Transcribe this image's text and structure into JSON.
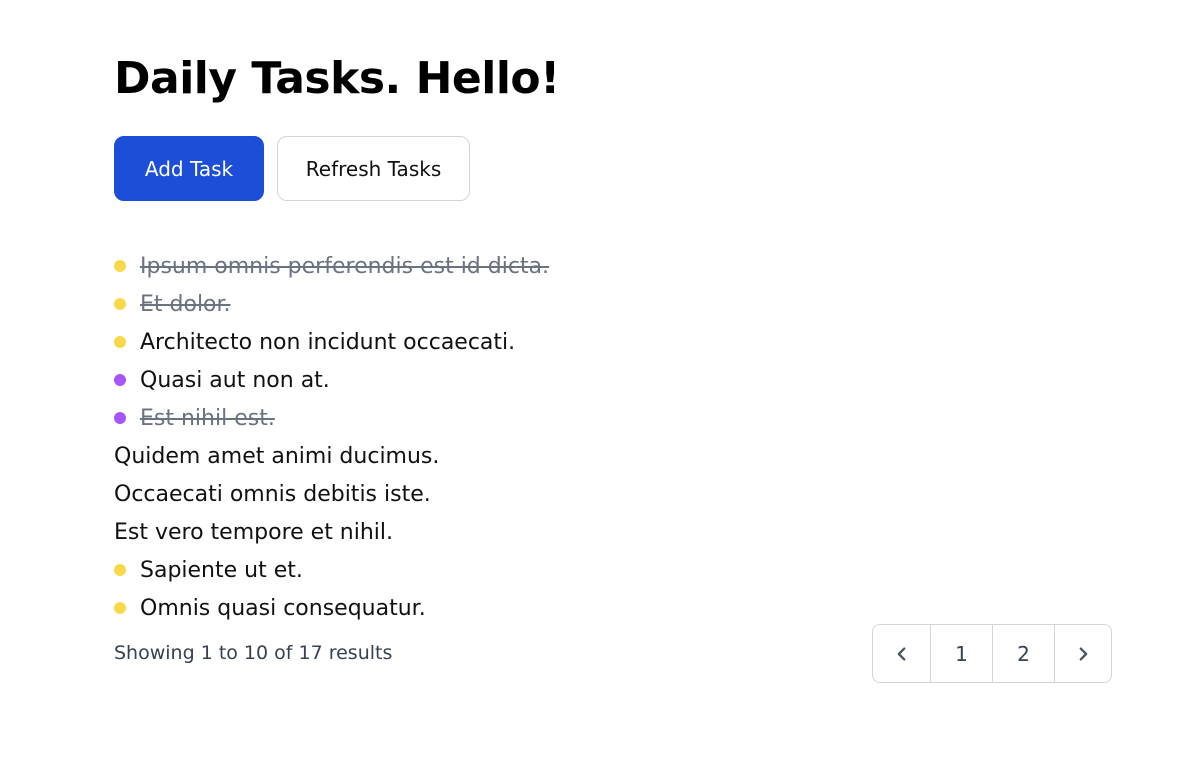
{
  "page": {
    "title": "Daily Tasks. Hello!"
  },
  "actions": {
    "add_label": "Add Task",
    "refresh_label": "Refresh Tasks"
  },
  "tasks": [
    {
      "text": "Ipsum omnis perferendis est id dicta.",
      "dot": "yellow",
      "done": true
    },
    {
      "text": "Et dolor.",
      "dot": "yellow",
      "done": true
    },
    {
      "text": "Architecto non incidunt occaecati.",
      "dot": "yellow",
      "done": false
    },
    {
      "text": "Quasi aut non at.",
      "dot": "purple",
      "done": false
    },
    {
      "text": "Est nihil est.",
      "dot": "purple",
      "done": true
    },
    {
      "text": "Quidem amet animi ducimus.",
      "dot": null,
      "done": false
    },
    {
      "text": "Occaecati omnis debitis iste.",
      "dot": null,
      "done": false
    },
    {
      "text": "Est vero tempore et nihil.",
      "dot": null,
      "done": false
    },
    {
      "text": "Sapiente ut et.",
      "dot": "yellow",
      "done": false
    },
    {
      "text": "Omnis quasi consequatur.",
      "dot": "yellow",
      "done": false
    }
  ],
  "pagination": {
    "summary": "Showing 1 to 10 of 17 results",
    "pages": [
      "1",
      "2"
    ],
    "prev_icon": "chevron-left-icon",
    "next_icon": "chevron-right-icon"
  },
  "colors": {
    "primary": "#1d4ed8",
    "dot_yellow": "#f9d94a",
    "dot_purple": "#a855f7",
    "done_text": "#6b7280"
  }
}
